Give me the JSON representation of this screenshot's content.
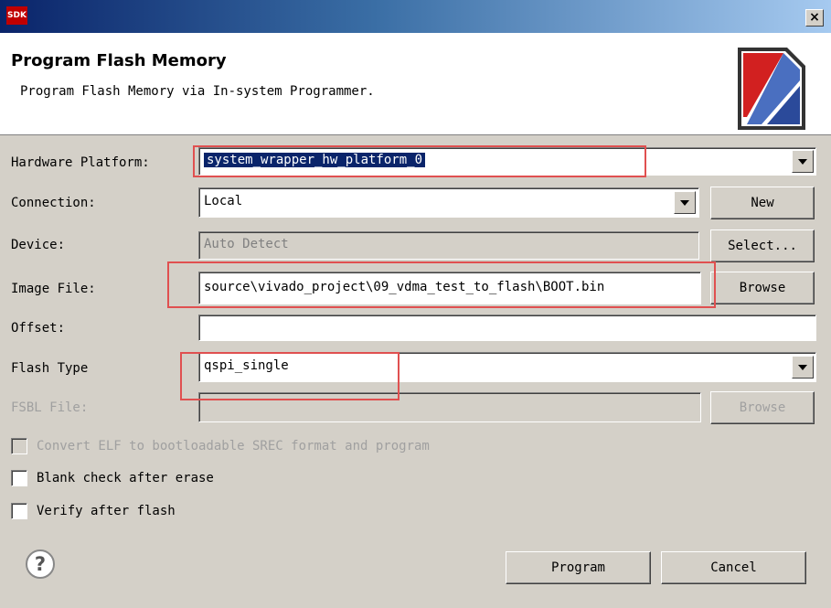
{
  "window": {
    "app_icon_text": "SDK",
    "close_symbol": "×"
  },
  "header": {
    "title": "Program Flash Memory",
    "description": "Program Flash Memory via In-system Programmer."
  },
  "form": {
    "hardware_platform": {
      "label": "Hardware Platform:",
      "value": "system_wrapper_hw_platform_0"
    },
    "connection": {
      "label": "Connection:",
      "value": "Local",
      "button": "New"
    },
    "device": {
      "label": "Device:",
      "value": "Auto Detect",
      "button": "Select..."
    },
    "image_file": {
      "label": "Image File:",
      "value": "source\\vivado_project\\09_vdma_test_to_flash\\BOOT.bin",
      "button": "Browse"
    },
    "offset": {
      "label": "Offset:",
      "value": ""
    },
    "flash_type": {
      "label": "Flash Type",
      "value": "qspi_single"
    },
    "fsbl_file": {
      "label": "FSBL File:",
      "value": "",
      "button": "Browse"
    }
  },
  "options": {
    "convert_elf": {
      "label": "Convert ELF to bootloadable SREC format and program",
      "checked": false,
      "enabled": false
    },
    "blank_check": {
      "label": "Blank check after erase",
      "checked": false
    },
    "verify": {
      "label": "Verify after flash",
      "checked": false
    }
  },
  "footer": {
    "help_symbol": "?",
    "program_button": "Program",
    "cancel_button": "Cancel"
  },
  "colors": {
    "selection": "#0a246a",
    "highlight": "#e05050",
    "dialog_bg": "#d4d0c8"
  }
}
